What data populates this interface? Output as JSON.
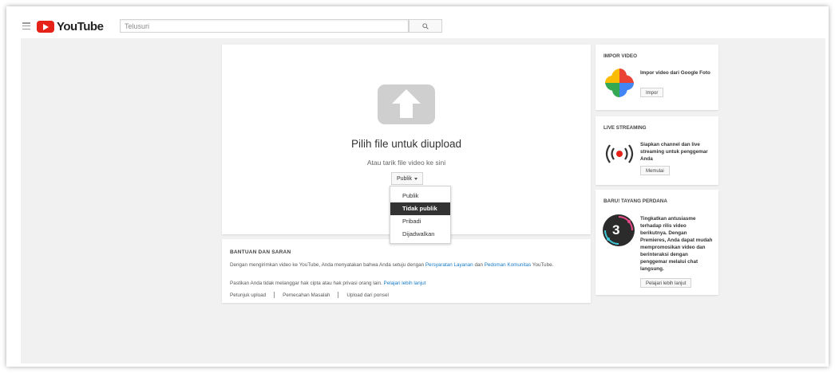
{
  "header": {
    "logo_text": "YouTube",
    "search": {
      "value": "Telusuri"
    }
  },
  "upload": {
    "title": "Pilih file untuk diupload",
    "subtitle": "Atau tarik file video ke sini",
    "privacy_button": "Publik",
    "menu": {
      "items": [
        {
          "label": "Publik",
          "selected": false
        },
        {
          "label": "Tidak publik",
          "selected": true
        },
        {
          "label": "Pribadi",
          "selected": false
        },
        {
          "label": "Dijadwalkan",
          "selected": false
        }
      ]
    }
  },
  "help": {
    "title": "BANTUAN DAN SARAN",
    "p1_start": "Dengan mengirimkan video ke YouTube, Anda menyatakan bahwa Anda setuju dengan ",
    "p1_link1": "Persyaratan Layanan",
    "p1_mid": " dan ",
    "p1_link2": "Pedoman Komunitas",
    "p1_end": " YouTube.",
    "p2_start": "Pastikan Anda tidak melanggar hak cipta atau hak privasi orang lain. ",
    "p2_link": "Pelajari lebih lanjut",
    "links": [
      "Petunjuk upload",
      "Pemecahan Masalah",
      "Upload dari ponsel"
    ]
  },
  "sidebar": {
    "import": {
      "title": "IMPOR VIDEO",
      "text": "Impor video dari Google Foto",
      "button": "Impor"
    },
    "live": {
      "title": "LIVE STREAMING",
      "text": "Siapkan channel dan live streaming untuk penggemar Anda",
      "button": "Memulai"
    },
    "premiere": {
      "title": "BARU! TAYANG PERDANA",
      "text": "Tingkatkan antusiasme terhadap rilis video berikutnya. Dengan Premieres, Anda dapat mudah mempromosikan video dan berinteraksi dengan penggemar melalui chat langsung.",
      "button": "Pelajari lebih lanjut",
      "icon_number": "3"
    }
  },
  "colors": {
    "brand_red": "#e62117",
    "link_blue": "#167ac6",
    "menu_selected": "#333333"
  }
}
